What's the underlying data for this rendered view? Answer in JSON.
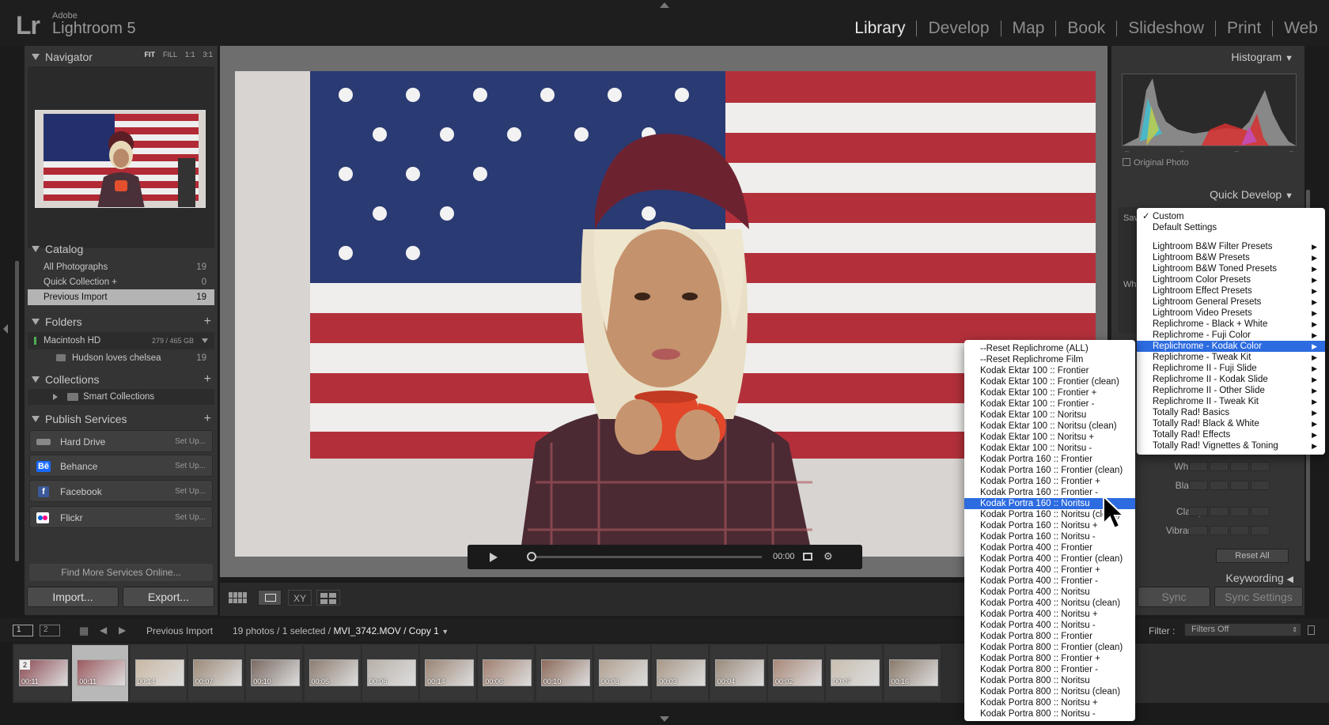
{
  "app": {
    "logo": "Lr",
    "vendor": "Adobe",
    "name": "Lightroom 5"
  },
  "modules": [
    "Library",
    "Develop",
    "Map",
    "Book",
    "Slideshow",
    "Print",
    "Web"
  ],
  "left": {
    "navigator": {
      "title": "Navigator",
      "options": [
        "FIT",
        "FILL",
        "1:1",
        "3:1"
      ]
    },
    "catalog": {
      "title": "Catalog",
      "items": [
        {
          "label": "All Photographs",
          "count": "19"
        },
        {
          "label": "Quick Collection +",
          "count": "0"
        },
        {
          "label": "Previous Import",
          "count": "19"
        }
      ]
    },
    "folders": {
      "title": "Folders",
      "drive": "Macintosh HD",
      "drive_size": "279 / 465 GB",
      "folder": "Hudson loves chelsea",
      "folder_count": "19"
    },
    "collections": {
      "title": "Collections",
      "item": "Smart Collections"
    },
    "publish": {
      "title": "Publish Services",
      "items": [
        {
          "label": "Hard Drive",
          "action": "Set Up..."
        },
        {
          "label": "Behance",
          "action": "Set Up...",
          "icon_text": "Bē"
        },
        {
          "label": "Facebook",
          "action": "Set Up...",
          "icon_text": "f"
        },
        {
          "label": "Flickr",
          "action": "Set Up..."
        }
      ],
      "find_more": "Find More Services Online..."
    },
    "import_label": "Import...",
    "export_label": "Export..."
  },
  "video": {
    "time": "00:00"
  },
  "right": {
    "histogram": {
      "title": "Histogram",
      "original_photo": "Original Photo"
    },
    "quick_develop": {
      "title": "Quick Develop",
      "saved_label": "Sav",
      "wb_label": "Wh",
      "rows": [
        "Whites",
        "Blacks",
        "Clarity",
        "Vibrance"
      ],
      "reset_all": "Reset All"
    },
    "keywording": "Keywording",
    "sync_label": "Sync",
    "sync_settings_label": "Sync Settings"
  },
  "filmbar": {
    "page1": "1",
    "page2": "2",
    "source": "Previous Import",
    "info_prefix": "19 photos / 1 selected /",
    "filename": "MVI_3742.MOV / Copy 1",
    "filter_label": "Filter :",
    "filter_value": "Filters Off"
  },
  "filmstrip": {
    "badge": "2",
    "durations": [
      "00:11",
      "00:11",
      "00:14",
      "00:07",
      "00:10",
      "00:05",
      "00:06",
      "00:14",
      "00:06",
      "00:10",
      "00:08",
      "00:03",
      "00:04",
      "00:02",
      "00:07",
      "00:16"
    ]
  },
  "preset_menu": {
    "items": [
      "Custom",
      "Default Settings",
      "",
      "Lightroom B&W Filter Presets",
      "Lightroom B&W Presets",
      "Lightroom B&W Toned Presets",
      "Lightroom Color Presets",
      "Lightroom Effect Presets",
      "Lightroom General Presets",
      "Lightroom Video Presets",
      "Replichrome - Black + White",
      "Replichrome - Fuji Color",
      "Replichrome - Kodak Color",
      "Replichrome - Tweak Kit",
      "Replichrome II - Fuji Slide",
      "Replichrome II - Kodak Slide",
      "Replichrome II - Other Slide",
      "Replichrome II - Tweak Kit",
      "Totally Rad! Basics",
      "Totally Rad! Black & White",
      "Totally Rad! Effects",
      "Totally Rad! Vignettes & Toning"
    ],
    "checked": "Custom",
    "highlighted": "Replichrome - Kodak Color"
  },
  "sub_menu": {
    "items": [
      "--Reset Replichrome (ALL)",
      "--Reset Replichrome Film",
      "Kodak Ektar 100 :: Frontier",
      "Kodak Ektar 100 :: Frontier (clean)",
      "Kodak Ektar 100 :: Frontier +",
      "Kodak Ektar 100 :: Frontier -",
      "Kodak Ektar 100 :: Noritsu",
      "Kodak Ektar 100 :: Noritsu (clean)",
      "Kodak Ektar 100 :: Noritsu +",
      "Kodak Ektar 100 :: Noritsu -",
      "Kodak Portra 160 :: Frontier",
      "Kodak Portra 160 :: Frontier (clean)",
      "Kodak Portra 160 :: Frontier +",
      "Kodak Portra 160 :: Frontier -",
      "Kodak Portra 160 :: Noritsu",
      "Kodak Portra 160 :: Noritsu (clean)",
      "Kodak Portra 160 :: Noritsu +",
      "Kodak Portra 160 :: Noritsu -",
      "Kodak Portra 400 :: Frontier",
      "Kodak Portra 400 :: Frontier (clean)",
      "Kodak Portra 400 :: Frontier +",
      "Kodak Portra 400 :: Frontier -",
      "Kodak Portra 400 :: Noritsu",
      "Kodak Portra 400 :: Noritsu (clean)",
      "Kodak Portra 400 :: Noritsu +",
      "Kodak Portra 400 :: Noritsu -",
      "Kodak Portra 800 :: Frontier",
      "Kodak Portra 800 :: Frontier (clean)",
      "Kodak Portra 800 :: Frontier +",
      "Kodak Portra 800 :: Frontier -",
      "Kodak Portra 800 :: Noritsu",
      "Kodak Portra 800 :: Noritsu (clean)",
      "Kodak Portra 800 :: Noritsu +",
      "Kodak Portra 800 :: Noritsu -"
    ],
    "highlighted": "Kodak Portra 160 :: Noritsu"
  },
  "colors": {
    "menu_highlight": "#2c6be0",
    "selected_row": "#b4b4b4"
  }
}
